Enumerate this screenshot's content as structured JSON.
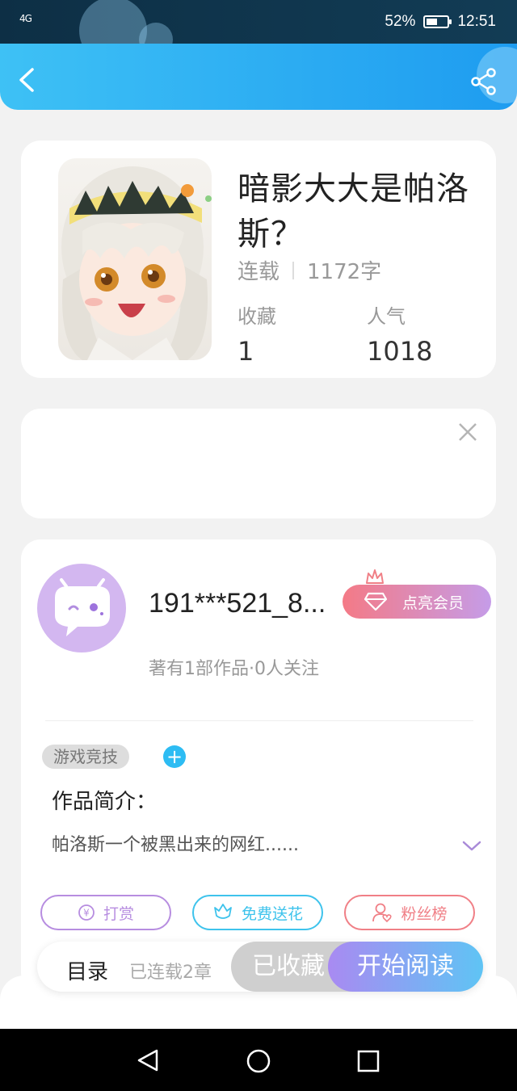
{
  "status_bar": {
    "signal": "4G",
    "battery": "52%",
    "time": "12:51"
  },
  "header": {
    "back_icon": "back-chevron-icon",
    "share_icon": "share-icon"
  },
  "book": {
    "title": "暗影大大是帕洛斯？",
    "status": "连载",
    "word_count": "1172字",
    "favorites_label": "收藏",
    "favorites_value": "1",
    "popularity_label": "人气",
    "popularity_value": "1018"
  },
  "author": {
    "name": "191***521_8...",
    "vip_label": "点亮会员",
    "subtitle": "著有1部作品·0人关注",
    "tag": "游戏竞技",
    "tag_add": "+"
  },
  "intro": {
    "title": "作品简介：",
    "text": "帕洛斯一个被黑出来的网红......"
  },
  "actions": {
    "tip_label": "打赏",
    "flower_label": "免费送花",
    "fans_label": "粉丝榜"
  },
  "bottom_bar": {
    "toc_label": "目录",
    "chapters": "已连载2章",
    "collected_label": "已收藏",
    "read_label": "开始阅读"
  },
  "colors": {
    "header_start": "#3ec1f5",
    "header_end": "#1e9cf0",
    "tip": "#b78de0",
    "flower": "#3ec3ec",
    "fans": "#f07f86"
  }
}
